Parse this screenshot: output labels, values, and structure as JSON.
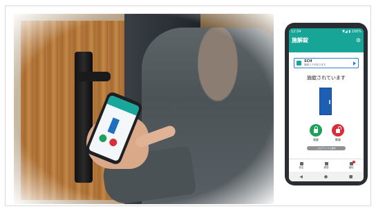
{
  "phone": {
    "status_left": "12:34",
    "status_right": "▼◢ ▮ 100%",
    "app_title": "施解錠",
    "card_name": "SCH",
    "card_sub": "施錠ドアがあります",
    "lock_status": "施錠されています",
    "lock_label": "施錠",
    "unlock_label": "解錠",
    "history_label": "このデバイスで操作",
    "nav": [
      "設定",
      "履歴",
      "通知"
    ],
    "sys_buttons": [
      "◀",
      "●",
      "■"
    ]
  }
}
